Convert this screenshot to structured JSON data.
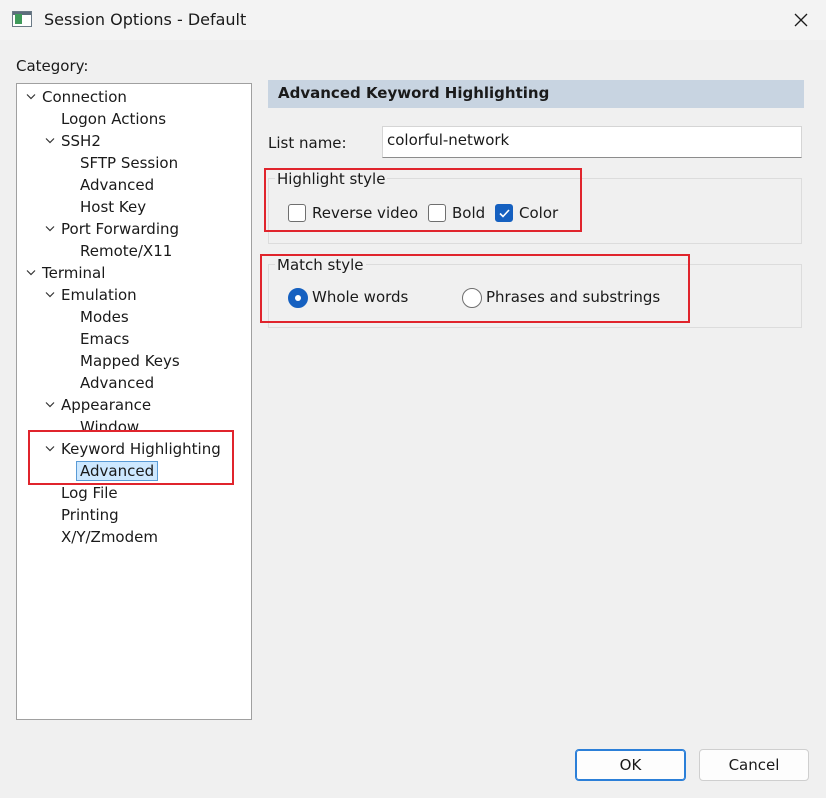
{
  "window": {
    "title": "Session Options - Default",
    "icon": "terminal-app-icon"
  },
  "category_label": "Category:",
  "tree": [
    {
      "label": "Connection",
      "expanded": true,
      "level": 0
    },
    {
      "label": "Logon Actions",
      "level": 1
    },
    {
      "label": "SSH2",
      "expanded": true,
      "level": 1
    },
    {
      "label": "SFTP Session",
      "level": 2
    },
    {
      "label": "Advanced",
      "level": 2
    },
    {
      "label": "Host Key",
      "level": 2
    },
    {
      "label": "Port Forwarding",
      "expanded": true,
      "level": 1
    },
    {
      "label": "Remote/X11",
      "level": 2
    },
    {
      "label": "Terminal",
      "expanded": true,
      "level": 0
    },
    {
      "label": "Emulation",
      "expanded": true,
      "level": 1
    },
    {
      "label": "Modes",
      "level": 2
    },
    {
      "label": "Emacs",
      "level": 2
    },
    {
      "label": "Mapped Keys",
      "level": 2
    },
    {
      "label": "Advanced",
      "level": 2
    },
    {
      "label": "Appearance",
      "expanded": true,
      "level": 1
    },
    {
      "label": "Window",
      "level": 2
    },
    {
      "label": "Keyword Highlighting",
      "expanded": true,
      "level": 1
    },
    {
      "label": "Advanced",
      "level": 2,
      "selected": true
    },
    {
      "label": "Log File",
      "level": 1
    },
    {
      "label": "Printing",
      "level": 1
    },
    {
      "label": "X/Y/Zmodem",
      "level": 1
    }
  ],
  "panel": {
    "header": "Advanced Keyword Highlighting",
    "list_name_label": "List name:",
    "list_name_value": "colorful-network",
    "highlight_style": {
      "title": "Highlight style",
      "options": [
        {
          "label": "Reverse video",
          "checked": false
        },
        {
          "label": "Bold",
          "checked": false
        },
        {
          "label": "Color",
          "checked": true
        }
      ]
    },
    "match_style": {
      "title": "Match style",
      "options": [
        {
          "label": "Whole words",
          "selected": true
        },
        {
          "label": "Phrases and substrings",
          "selected": false
        }
      ]
    }
  },
  "buttons": {
    "ok": "OK",
    "cancel": "Cancel"
  },
  "colors": {
    "accent": "#1560c0",
    "annotation_red": "#e0242c",
    "header_bg": "#c8d4e1",
    "selection_bg": "#cde8ff"
  }
}
